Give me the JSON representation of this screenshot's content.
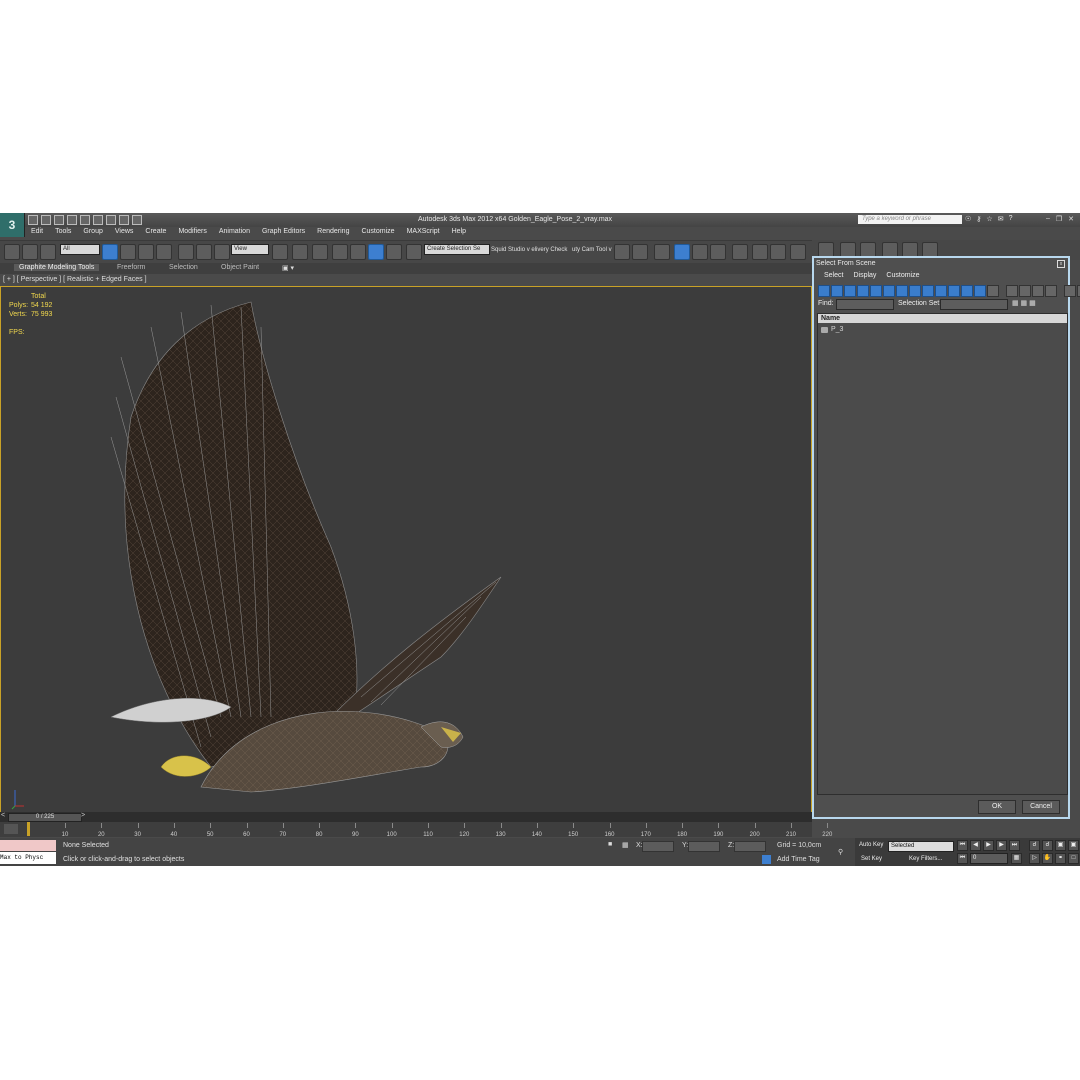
{
  "app": {
    "title": "Autodesk 3ds Max  2012 x64       Golden_Eagle_Pose_2_vray.max",
    "search_placeholder": "Type a keyword or phrase",
    "logo": "3ds-max-logo"
  },
  "menu": [
    "Edit",
    "Tools",
    "Group",
    "Views",
    "Create",
    "Modifiers",
    "Animation",
    "Graph Editors",
    "Rendering",
    "Customize",
    "MAXScript",
    "Help"
  ],
  "toolbar": {
    "filter_value": "All",
    "refcoord_value": "View",
    "selection_set": "Create Selection Se",
    "text1": "Squid Studio v elivery Check",
    "text2": "uty Cam Tool v"
  },
  "ribbon": [
    "Graphite Modeling Tools",
    "Freeform",
    "Selection",
    "Object Paint"
  ],
  "viewport": {
    "label": "[ + ] [ Perspective ] [ Realistic + Edged Faces ]",
    "stats_header": "Total",
    "polys_label": "Polys:",
    "polys_value": "54 192",
    "verts_label": "Verts:",
    "verts_value": "75 993",
    "fps_label": "FPS:"
  },
  "timeline": {
    "frame": "0 / 225",
    "ticks": [
      "10",
      "20",
      "30",
      "40",
      "50",
      "60",
      "70",
      "80",
      "90",
      "100",
      "110",
      "120",
      "130",
      "140",
      "150",
      "160",
      "170",
      "180",
      "190",
      "200",
      "210",
      "220"
    ]
  },
  "status": {
    "maxscript": "",
    "maxscript_text": "Max to Physc",
    "selection": "None Selected",
    "prompt": "Click or click-and-drag to select objects",
    "x_label": "X:",
    "y_label": "Y:",
    "z_label": "Z:",
    "grid": "Grid = 10,0cm",
    "add_time_tag": "Add Time Tag",
    "auto_key": "Auto Key",
    "selected": "Selected",
    "set_key": "Set Key",
    "key_filters": "Key Filters...",
    "frame_field": "0"
  },
  "dialog": {
    "title": "Select From Scene",
    "menu": [
      "Select",
      "Display",
      "Customize"
    ],
    "find_label": "Find:",
    "selection_set_label": "Selection Set:",
    "column_name": "Name",
    "items": [
      "P_3"
    ],
    "ok": "OK",
    "cancel": "Cancel"
  },
  "colors": {
    "viewport_bg": "#3c3c3c",
    "viewport_border": "#c9a227",
    "stats_text": "#f2d94e",
    "accent_blue": "#3d7fd0",
    "dialog_border": "#b8d8ee"
  }
}
